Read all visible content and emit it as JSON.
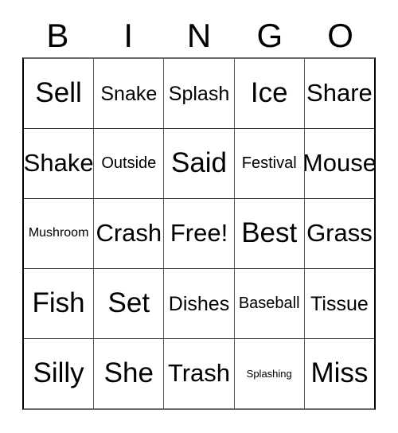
{
  "card": {
    "type": "bingo-card",
    "columns": 5,
    "rows": 5,
    "header": {
      "letters": [
        "B",
        "I",
        "N",
        "G",
        "O"
      ]
    },
    "colors": {
      "background": "#ffffff",
      "text": "#000000",
      "grid_line": "#5a5a5a",
      "outer_border": "#000000"
    },
    "grid": [
      [
        {
          "text": "Sell",
          "size": "sz-xl"
        },
        {
          "text": "Snake",
          "size": "sz-md"
        },
        {
          "text": "Splash",
          "size": "sz-md"
        },
        {
          "text": "Ice",
          "size": "sz-xl"
        },
        {
          "text": "Share",
          "size": "sz-lg"
        }
      ],
      [
        {
          "text": "Shake",
          "size": "sz-lg"
        },
        {
          "text": "Outside",
          "size": "sz-sm"
        },
        {
          "text": "Said",
          "size": "sz-xl"
        },
        {
          "text": "Festival",
          "size": "sz-sm"
        },
        {
          "text": "Mouse",
          "size": "sz-lg"
        }
      ],
      [
        {
          "text": "Mushroom",
          "size": "sz-xs"
        },
        {
          "text": "Crash",
          "size": "sz-lg"
        },
        {
          "text": "Free!",
          "size": "sz-lg"
        },
        {
          "text": "Best",
          "size": "sz-xl"
        },
        {
          "text": "Grass",
          "size": "sz-lg"
        }
      ],
      [
        {
          "text": "Fish",
          "size": "sz-xl"
        },
        {
          "text": "Set",
          "size": "sz-xl"
        },
        {
          "text": "Dishes",
          "size": "sz-md"
        },
        {
          "text": "Baseball",
          "size": "sz-sm"
        },
        {
          "text": "Tissue",
          "size": "sz-md"
        }
      ],
      [
        {
          "text": "Silly",
          "size": "sz-xl"
        },
        {
          "text": "She",
          "size": "sz-xl"
        },
        {
          "text": "Trash",
          "size": "sz-lg"
        },
        {
          "text": "Splashing",
          "size": "sz-xxs"
        },
        {
          "text": "Miss",
          "size": "sz-xl"
        }
      ]
    ]
  }
}
